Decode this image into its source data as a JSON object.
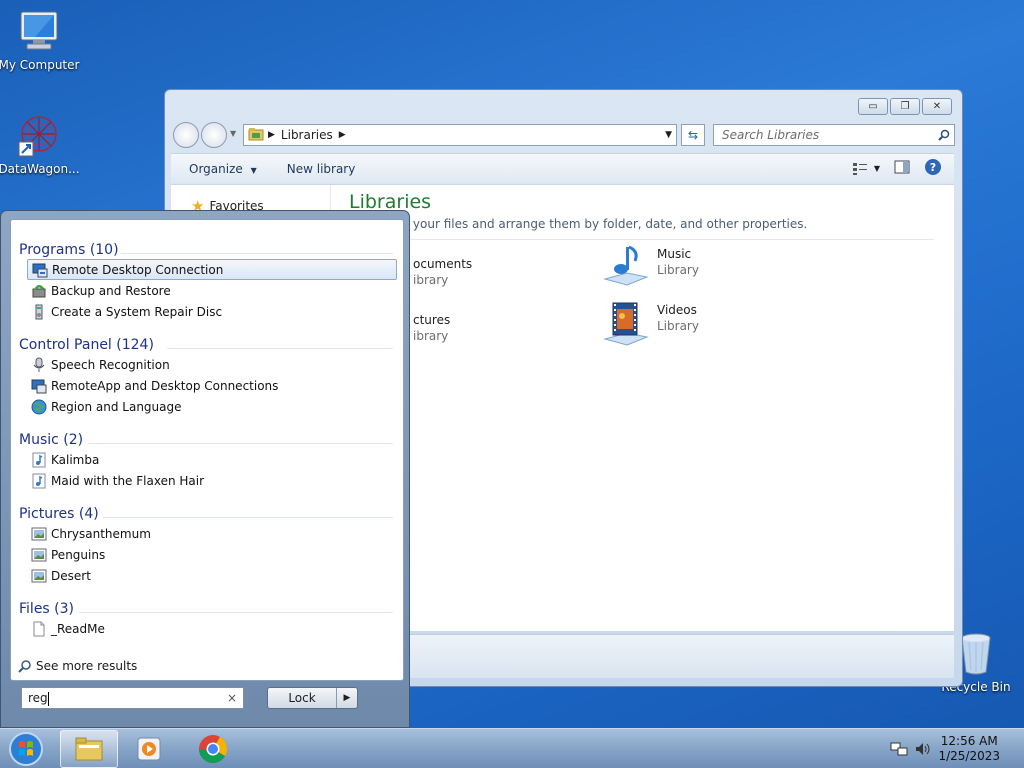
{
  "desktop": {
    "icons": [
      {
        "label": "My Computer"
      },
      {
        "label": "DataWagon..."
      },
      {
        "label": "Recycle Bin"
      }
    ]
  },
  "explorer": {
    "address": {
      "crumb": "Libraries"
    },
    "search_placeholder": "Search Libraries",
    "toolbar": {
      "organize": "Organize",
      "new_library": "New library"
    },
    "nav": {
      "favorites": "Favorites"
    },
    "title": "Libraries",
    "description": "ary to see your files and arrange them by folder, date, and other properties.",
    "libraries": [
      {
        "name": "ocuments",
        "type": "ibrary"
      },
      {
        "name": "Music",
        "type": "Library"
      },
      {
        "name": "ctures",
        "type": "ibrary"
      },
      {
        "name": "Videos",
        "type": "Library"
      }
    ]
  },
  "start_menu": {
    "groups": [
      {
        "header": "Programs (10)",
        "items": [
          "Remote Desktop Connection",
          "Backup and Restore",
          "Create a System Repair Disc"
        ]
      },
      {
        "header": "Control Panel (124)",
        "items": [
          "Speech Recognition",
          "RemoteApp and Desktop Connections",
          "Region and Language"
        ]
      },
      {
        "header": "Music (2)",
        "items": [
          "Kalimba",
          "Maid with the Flaxen Hair"
        ]
      },
      {
        "header": "Pictures (4)",
        "items": [
          "Chrysanthemum",
          "Penguins",
          "Desert"
        ]
      },
      {
        "header": "Files (3)",
        "items": [
          "_ReadMe"
        ]
      }
    ],
    "see_more": "See more results",
    "search_value": "reg",
    "clear_glyph": "×",
    "lock_label": "Lock"
  },
  "taskbar": {
    "clock_time": "12:56 AM",
    "clock_date": "1/25/2023"
  },
  "colors": {
    "group_header": "#1e3287",
    "library_title": "#1e7b34",
    "selection_border": "#84acdd"
  }
}
